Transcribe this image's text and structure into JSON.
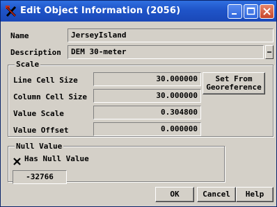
{
  "window": {
    "title": "Edit Object Information (2056)"
  },
  "fields": {
    "name_label": "Name",
    "name_value": "JerseyIsland",
    "description_label": "Description",
    "description_value": "DEM 30-meter"
  },
  "scale": {
    "group_label": "Scale",
    "line_cell_size_label": "Line Cell Size",
    "line_cell_size_value": "30.000000",
    "column_cell_size_label": "Column Cell Size",
    "column_cell_size_value": "30.000000",
    "value_scale_label": "Value Scale",
    "value_scale_value": "0.304800",
    "value_offset_label": "Value Offset",
    "value_offset_value": "0.000000",
    "set_from_georeference_label": "Set From\nGeoreference"
  },
  "null_value": {
    "group_label": "Null Value",
    "has_null_value_label": "Has Null Value",
    "has_null_value_checked": true,
    "null_value": "-32766"
  },
  "buttons": {
    "ok": "OK",
    "cancel": "Cancel",
    "help": "Help"
  },
  "icons": {
    "app": "microimages-x-icon",
    "minimize": "minimize-icon",
    "maximize": "maximize-icon",
    "close": "close-icon"
  }
}
